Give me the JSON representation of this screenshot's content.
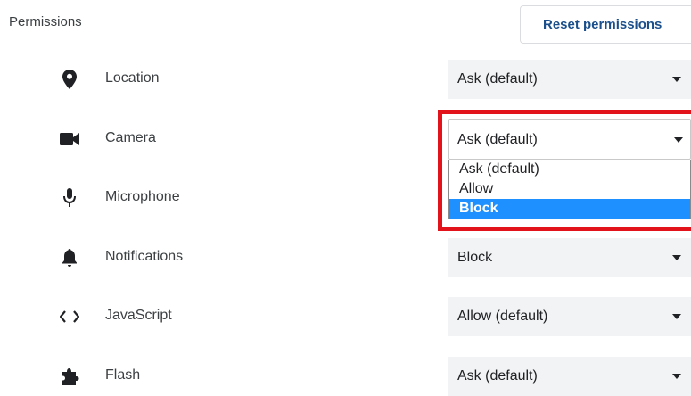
{
  "header": {
    "section_title": "Permissions",
    "reset_label": "Reset permissions"
  },
  "permissions": [
    {
      "icon": "location-pin-icon",
      "label": "Location",
      "value": "Ask (default)"
    },
    {
      "icon": "camera-icon",
      "label": "Camera",
      "value": "Ask (default)"
    },
    {
      "icon": "microphone-icon",
      "label": "Microphone",
      "value": ""
    },
    {
      "icon": "bell-icon",
      "label": "Notifications",
      "value": "Block"
    },
    {
      "icon": "code-brackets-icon",
      "label": "JavaScript",
      "value": "Allow (default)"
    },
    {
      "icon": "puzzle-piece-icon",
      "label": "Flash",
      "value": "Ask (default)"
    }
  ],
  "camera_dropdown": {
    "options": [
      "Ask (default)",
      "Allow",
      "Block"
    ],
    "highlighted_option": "Block"
  },
  "colors": {
    "highlight_border": "#e3131b",
    "option_highlight": "#1e90ff",
    "reset_text": "#1a4f8b"
  }
}
